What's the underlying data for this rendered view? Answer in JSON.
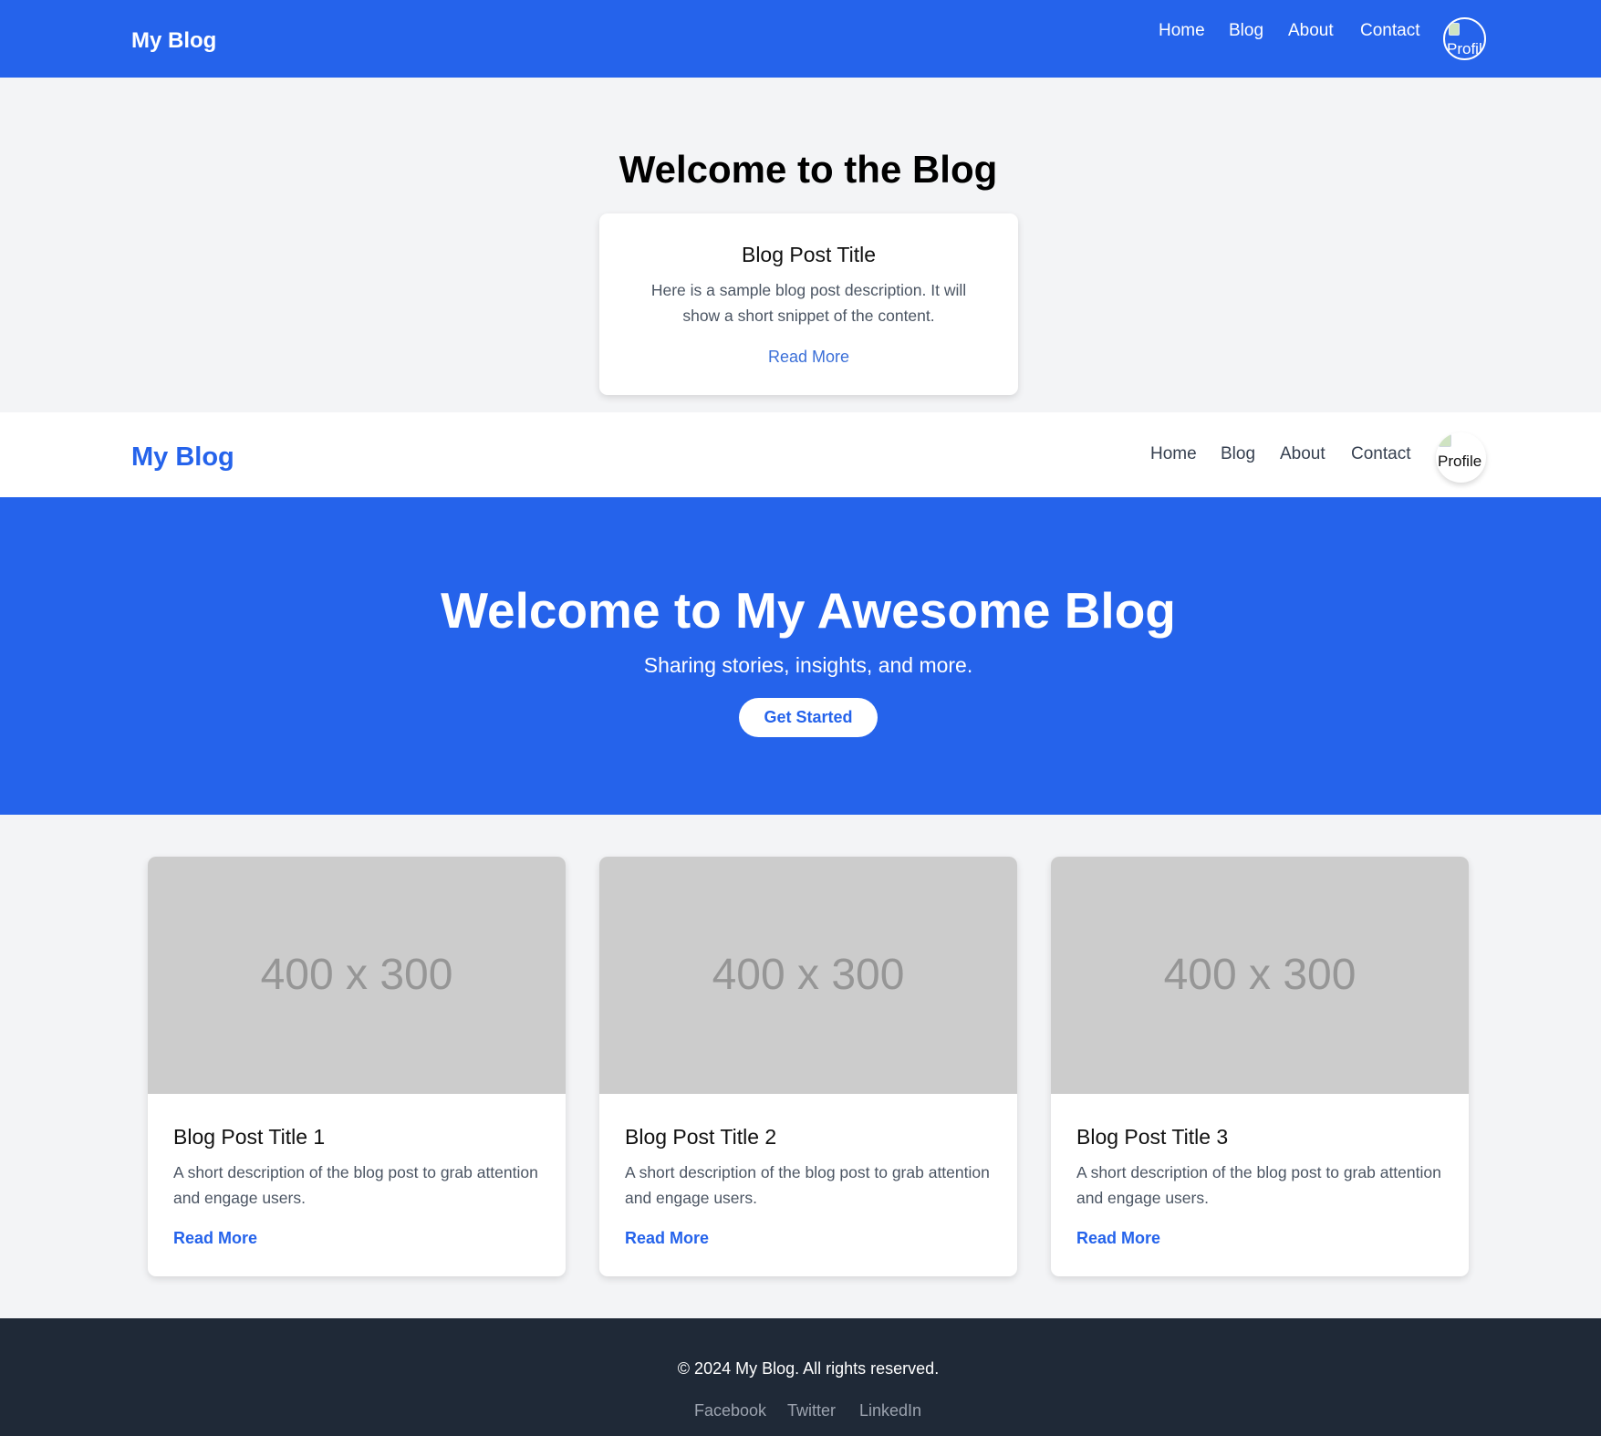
{
  "top_header": {
    "brand": "My Blog",
    "nav": [
      "Home",
      "Blog",
      "About",
      "Contact"
    ],
    "avatar_alt": "Profile"
  },
  "intro": {
    "title": "Welcome to the Blog",
    "card": {
      "title": "Blog Post Title",
      "description": "Here is a sample blog post description. It will show a short snippet of the content.",
      "link": "Read More"
    }
  },
  "second_header": {
    "brand": "My Blog",
    "nav": [
      "Home",
      "Blog",
      "About",
      "Contact"
    ],
    "avatar_alt": "Profile"
  },
  "hero": {
    "title": "Welcome to My Awesome Blog",
    "subtitle": "Sharing stories, insights, and more.",
    "button": "Get Started"
  },
  "posts": [
    {
      "image_placeholder": "400 x 300",
      "title": "Blog Post Title 1",
      "description": "A short description of the blog post to grab attention and engage users.",
      "link": "Read More"
    },
    {
      "image_placeholder": "400 x 300",
      "title": "Blog Post Title 2",
      "description": "A short description of the blog post to grab attention and engage users.",
      "link": "Read More"
    },
    {
      "image_placeholder": "400 x 300",
      "title": "Blog Post Title 3",
      "description": "A short description of the blog post to grab attention and engage users.",
      "link": "Read More"
    }
  ],
  "footer": {
    "copyright": "© 2024 My Blog. All rights reserved.",
    "links": [
      "Facebook",
      "Twitter",
      "LinkedIn"
    ]
  },
  "colors": {
    "primary": "#2563eb",
    "background": "#f3f4f6",
    "footer": "#1f2937",
    "placeholder": "#cccccc"
  }
}
